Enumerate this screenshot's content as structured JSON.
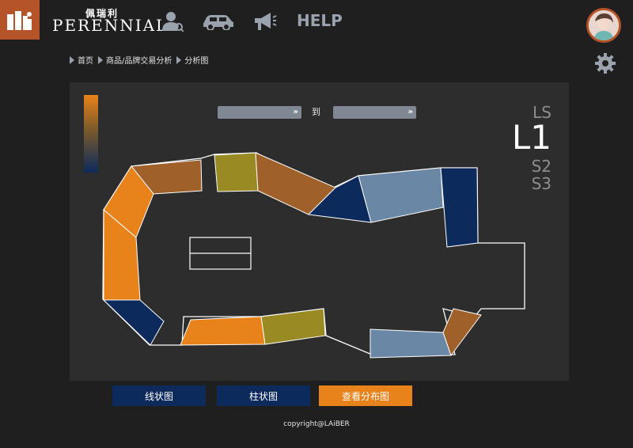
{
  "header": {
    "brand_cn": "佩瑞利",
    "brand_en": "PERENNIAL",
    "help_label": "HELP",
    "icons": [
      "logo-icon",
      "user-search-icon",
      "car-icon",
      "megaphone-icon",
      "avatar",
      "gear-icon"
    ]
  },
  "breadcrumb": [
    "首页",
    "商品/品牌交易分析",
    "分析图"
  ],
  "filters": {
    "from_value": "",
    "to_label": "到",
    "to_value": ""
  },
  "floors": [
    "LS",
    "L1",
    "S2",
    "S3"
  ],
  "active_floor": "L1",
  "legend": {
    "gradient_colors": [
      "#e8821a",
      "#0c2a5c"
    ]
  },
  "buttons": {
    "line_chart": "线状图",
    "bar_chart": "柱状图",
    "distribution": "查看分布图"
  },
  "colors": {
    "accent": "#b55428",
    "orange": "#e8821a",
    "navy": "#0c2a5c",
    "steel": "#6b87a6",
    "olive": "#9a8a24",
    "brown": "#a0602a"
  },
  "copyright": "copyright@LAiBER"
}
